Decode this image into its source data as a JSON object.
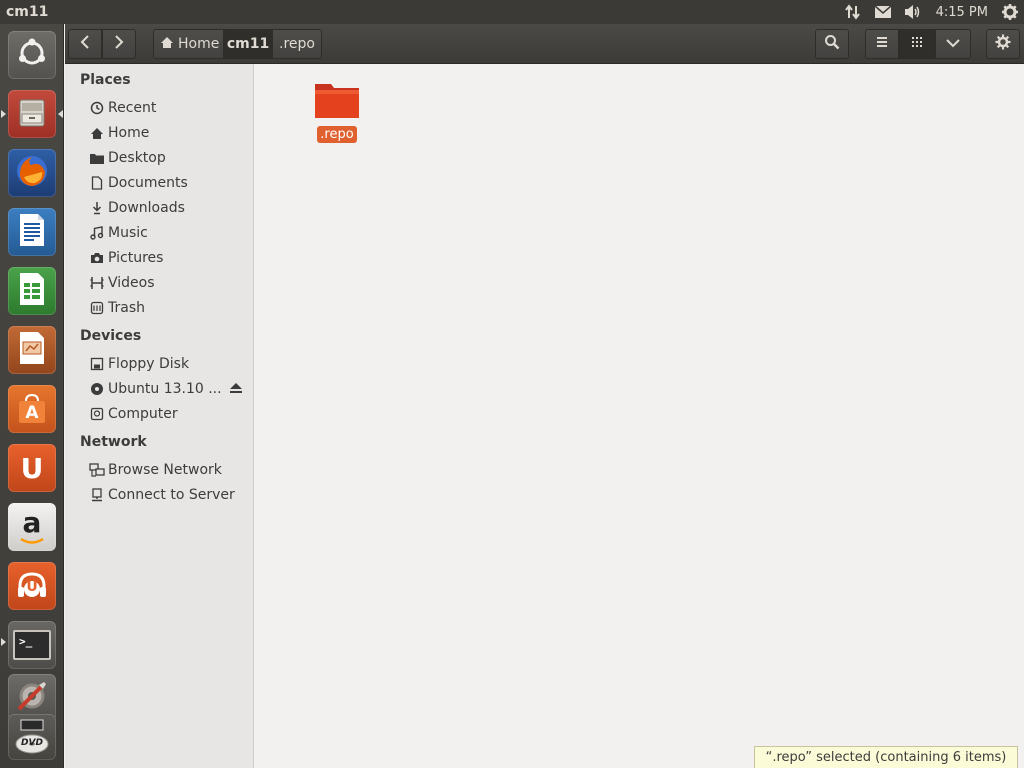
{
  "top_panel": {
    "app_title": "cm11",
    "clock": "4:15 PM",
    "indicators": [
      "network-icon",
      "mail-icon",
      "volume-icon",
      "settings-gear-icon"
    ]
  },
  "launcher": {
    "items": [
      {
        "name": "dash-home",
        "icon": "ubuntu-logo-icon"
      },
      {
        "name": "files",
        "icon": "file-cabinet-icon",
        "running": true,
        "focused": true
      },
      {
        "name": "firefox",
        "icon": "firefox-icon"
      },
      {
        "name": "libreoffice-writer",
        "icon": "writer-icon"
      },
      {
        "name": "libreoffice-calc",
        "icon": "calc-icon"
      },
      {
        "name": "libreoffice-impress",
        "icon": "impress-icon"
      },
      {
        "name": "software-center",
        "icon": "software-center-icon"
      },
      {
        "name": "ubuntu-one",
        "icon": "ubuntu-one-icon"
      },
      {
        "name": "amazon",
        "icon": "amazon-icon"
      },
      {
        "name": "ubuntu-one-music",
        "icon": "ubuntu-one-music-icon"
      },
      {
        "name": "terminal",
        "icon": "terminal-icon",
        "running": true
      },
      {
        "name": "system-settings",
        "icon": "system-settings-icon"
      },
      {
        "name": "dvd",
        "icon": "dvd-icon"
      }
    ],
    "amazon_letter": "a",
    "ubuntu_one_letter": "U",
    "software_center_letter": "A",
    "terminal_prompt": ">_",
    "dvd_text": "DVD"
  },
  "headerbar": {
    "breadcrumbs": [
      {
        "label": "Home",
        "icon": "home-icon"
      },
      {
        "label": "cm11",
        "active": true
      },
      {
        "label": ".repo"
      }
    ]
  },
  "sidebar": {
    "sections": [
      {
        "title": "Places",
        "items": [
          {
            "label": "Recent",
            "icon": "recent-clock-icon"
          },
          {
            "label": "Home",
            "icon": "home-icon"
          },
          {
            "label": "Desktop",
            "icon": "folder-icon"
          },
          {
            "label": "Documents",
            "icon": "document-icon"
          },
          {
            "label": "Downloads",
            "icon": "download-icon"
          },
          {
            "label": "Music",
            "icon": "music-note-icon"
          },
          {
            "label": "Pictures",
            "icon": "camera-icon"
          },
          {
            "label": "Videos",
            "icon": "film-icon"
          },
          {
            "label": "Trash",
            "icon": "trash-icon"
          }
        ]
      },
      {
        "title": "Devices",
        "items": [
          {
            "label": "Floppy Disk",
            "icon": "floppy-icon"
          },
          {
            "label": "Ubuntu 13.10 ...",
            "icon": "disc-icon"
          },
          {
            "label": "Computer",
            "icon": "harddisk-icon"
          }
        ]
      },
      {
        "title": "Network",
        "items": [
          {
            "label": "Browse Network",
            "icon": "network-icon"
          },
          {
            "label": "Connect to Server",
            "icon": "server-icon"
          }
        ]
      }
    ]
  },
  "content": {
    "files": [
      {
        "name": ".repo",
        "type": "folder",
        "selected": true,
        "color": "#e0602f"
      }
    ]
  },
  "status": {
    "text": "“.repo” selected  (containing 6 items)"
  },
  "colors": {
    "accent": "#e0602f",
    "panel": "#3b3a36",
    "sidebar": "#e7e6e4",
    "content": "#f2f1f0"
  }
}
